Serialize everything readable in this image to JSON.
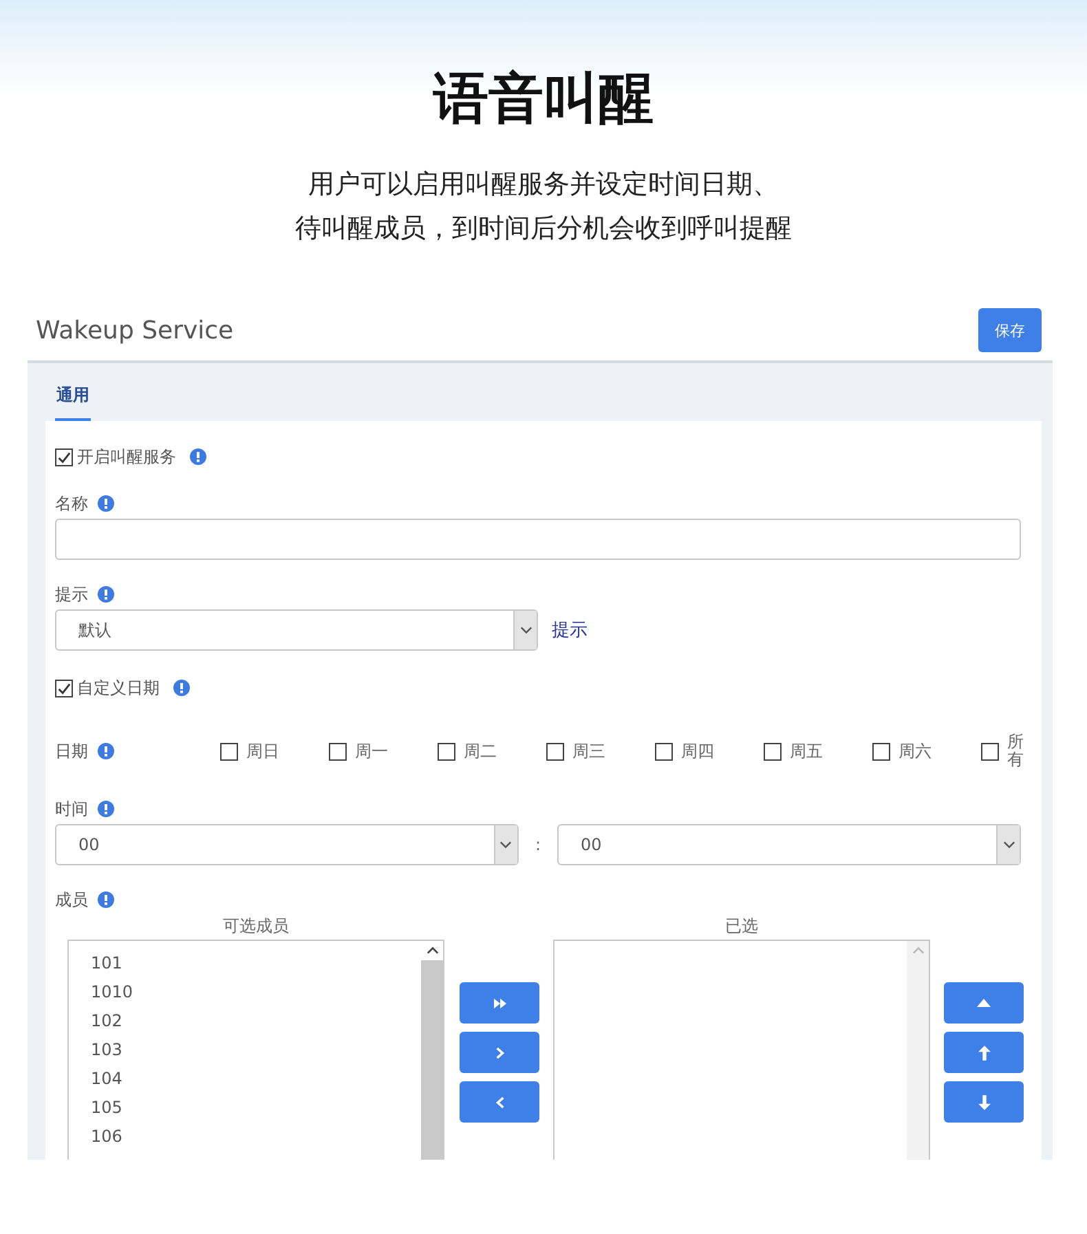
{
  "headline": "语音叫醒",
  "intro": [
    "用户可以启用叫醒服务并设定时间日期、",
    "待叫醒成员，到时间后分机会收到呼叫提醒"
  ],
  "panel": {
    "title": "Wakeup Service",
    "save_button": "保存",
    "tabs": [
      {
        "label": "通用",
        "selected": true
      }
    ]
  },
  "form": {
    "enable": {
      "label": "开启叫醒服务",
      "checked": true
    },
    "name": {
      "label": "名称"
    },
    "prompt": {
      "label": "提示",
      "value": "默认",
      "link": "提示"
    },
    "custom_date": {
      "label": "自定义日期",
      "checked": true
    },
    "days": {
      "label": "日期",
      "options": [
        {
          "label": "周日",
          "checked": false
        },
        {
          "label": "周一",
          "checked": false
        },
        {
          "label": "周二",
          "checked": false
        },
        {
          "label": "周三",
          "checked": false
        },
        {
          "label": "周四",
          "checked": false
        },
        {
          "label": "周五",
          "checked": false
        },
        {
          "label": "周六",
          "checked": false
        },
        {
          "label": "所有",
          "checked": false
        }
      ]
    },
    "time": {
      "label": "时间",
      "hour": "00",
      "separator": ":",
      "minute": "00"
    },
    "members": {
      "label": "成员",
      "available_title": "可选成员",
      "selected_title": "已选",
      "available": [
        "101",
        "1010",
        "102",
        "103",
        "104",
        "105",
        "106"
      ]
    }
  }
}
